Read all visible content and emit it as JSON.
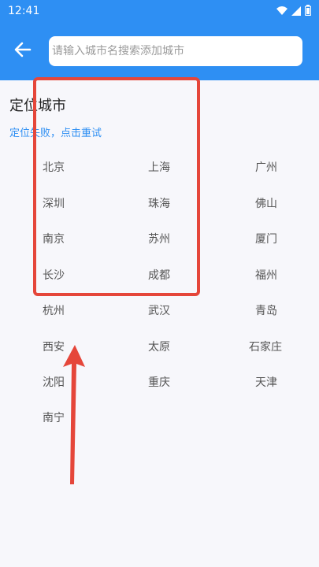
{
  "status_bar": {
    "time": "12:41",
    "icons": [
      "wifi-icon",
      "signal-icon",
      "battery-icon"
    ]
  },
  "header": {
    "back_icon": "arrow-left-icon",
    "search_placeholder": "请输入城市名搜索添加城市",
    "search_value": ""
  },
  "location": {
    "title": "定位城市",
    "status_text": "定位失败，点击重试"
  },
  "cities": [
    "北京",
    "上海",
    "广州",
    "深圳",
    "珠海",
    "佛山",
    "南京",
    "苏州",
    "厦门",
    "长沙",
    "成都",
    "福州",
    "杭州",
    "武汉",
    "青岛",
    "西安",
    "太原",
    "石家庄",
    "沈阳",
    "重庆",
    "天津",
    "南宁"
  ],
  "colors": {
    "primary": "#2e8ff3",
    "background": "#f7f7fb",
    "annotation": "#e5463a"
  }
}
